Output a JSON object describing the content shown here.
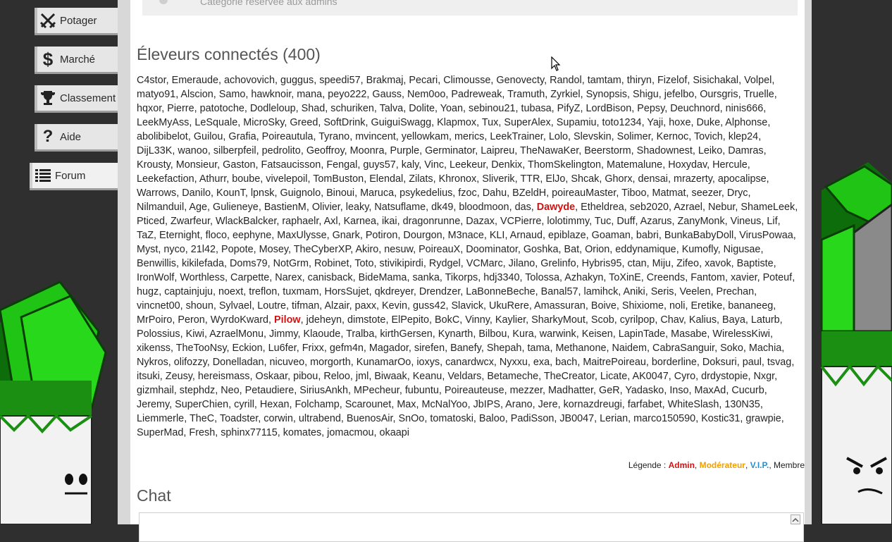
{
  "nav": [
    {
      "label": "Potager",
      "icon": "swords-icon"
    },
    {
      "label": "Marché",
      "icon": "dollar-icon"
    },
    {
      "label": "Classement",
      "icon": "trophy-icon"
    },
    {
      "label": "Aide",
      "icon": "question-icon"
    },
    {
      "label": "Forum",
      "icon": "list-icon"
    }
  ],
  "category_note": "Catégorie réservée aux admins",
  "online_title": "Éleveurs connectés (400)",
  "users": [
    "C4stor",
    "Emeraude",
    "achovovich",
    "guggus",
    "speedi57",
    "Brakmaj",
    "Pecari",
    "Climousse",
    "Genovecty",
    "Randol",
    "tamtam",
    "thiryn",
    "Fizelof",
    "Sisichakal",
    "Volpel",
    "matyo91",
    "Alscion",
    "Samo",
    "hawknoir",
    "mana",
    "peyo222",
    "Gauss",
    "Nem0oo",
    "Padreweak",
    "Tramuth",
    "Zyrkiel",
    "Synopsis",
    "Shigu",
    "jefelbo",
    "Oursgris",
    "Truelle",
    "hqxor",
    "Pierre",
    "patotoche",
    "Dodleloup",
    "Shad",
    "schuriken",
    "Talva",
    "Dolite",
    "Yoan",
    "sebinou21",
    "tubasa",
    "PifyZ",
    "LordBison",
    "Pepsy",
    "Deuchnord",
    "ninis666",
    "LeekMyAss",
    "LeSquale",
    "MicroSky",
    "Greed",
    "SoftDrink",
    "GuiguiSwagg",
    "Klapmox",
    "Tux",
    "SuperAlex",
    "Supamiu",
    "toto1234",
    "Yaji",
    "hoxe",
    "Duke",
    "Alphonse",
    "abolibibelot",
    "Guilou",
    "Grafia",
    "Poireautula",
    "Tyrano",
    "mvincent",
    "yellowkam",
    "merics",
    "LeekTrainer",
    "Lolo",
    "Slevskin",
    "Solimer",
    "Kernoc",
    "Tovich",
    "klep24",
    "DijL33K",
    "wanoo",
    "silberpfeil",
    "pedrolito",
    "Geoffroy",
    "Moonra",
    "Purple",
    "Germinator",
    "Laipreu",
    "TheNawaKer",
    "Beerstorm",
    "Shadownest",
    "Leiko",
    "Damras",
    "Krousty",
    "Monsieur",
    "Gaston",
    "Fatsaucisson",
    "Fengal",
    "guys57",
    "kaly",
    "Vinc",
    "Leekeur",
    "Denkix",
    "ThomSkelington",
    "Matemalune",
    "Hoxydav",
    "Hercule",
    "Leekefaction",
    "Athurr",
    "boube",
    "vivelepoil",
    "TomBuston",
    "Elendal",
    "Zilats",
    "Khronox",
    "Sliverik",
    "TTR",
    "ElJo",
    "Shcak",
    "Ghorx",
    "densai",
    "mrazerty",
    "apocalipse",
    "Warrows",
    "Danilo",
    "KounT",
    "lpnsk",
    "Guignolo",
    "Binoui",
    "Maruca",
    "psykedelius",
    "fzoc",
    "Dahu",
    "BZeldH",
    "poireauMaster",
    "Tiboo",
    "Matmat",
    "seezer",
    "Dryc",
    "Nilmanduil",
    "Age",
    "Gulieneye",
    "BastienM",
    "Olivier",
    "leaky",
    "Natsuflame",
    "dk49",
    "bloodmoon",
    "das",
    "Dawyde",
    "Etheldrea",
    "seb2020",
    "Azrael",
    "Nebur",
    "ShameLeek",
    "Pticed",
    "Zwarfeur",
    "WlackBalcker",
    "raphaelr",
    "Axl",
    "Karnea",
    "ikai",
    "dragonrunne",
    "Dazax",
    "VCPierre",
    "lolotimmy",
    "Tuc",
    "Duff",
    "Azarus",
    "ZanyMonk",
    "Vineus",
    "Lif",
    "TaZ",
    "Eternight",
    "floco",
    "eephyne",
    "MaxUlysse",
    "Gnark",
    "Potiron",
    "Dourgon",
    "M3nace",
    "KLI",
    "Arnaud",
    "epiblaze",
    "Goaman",
    "babri",
    "BunkaBabyDoll",
    "VirusPowaa",
    "Myst",
    "nyco",
    "21l42",
    "Popote",
    "Mosey",
    "TheCyberXP",
    "Akiro",
    "nesuw",
    "PoireauX",
    "Doominator",
    "Goshka",
    "Bat",
    "Orion",
    "eddynamique",
    "Kumofly",
    "Nigusae",
    "Benwillis",
    "kikilefada",
    "Doms79",
    "NotGrm",
    "Robinet",
    "Toto",
    "stivikipirdi",
    "Rydgel",
    "VCMarc",
    "Jilano",
    "Grelinfo",
    "Hybris95",
    "ctan",
    "Miju",
    "Zifeo",
    "xavok",
    "Baptiste",
    "IronWolf",
    "Worthless",
    "Carpette",
    "Narex",
    "canisback",
    "BideMama",
    "sanka",
    "Tikorps",
    "hdj3340",
    "Tolossa",
    "Azhakyn",
    "ToXinE",
    "Creends",
    "Fantom",
    "xavier",
    "Poteuf",
    "hugz",
    "captainjuju",
    "noext",
    "treflon",
    "tuxmam",
    "HorsSujet",
    "qkdreyer",
    "Drendzer",
    "LaBonneBeche",
    "Banal57",
    "lamihck",
    "Aniki",
    "Seris",
    "Veelen",
    "Prechan",
    "vincnet00",
    "shoun",
    "Sylvael",
    "Loutre",
    "tifman",
    "Alzair",
    "paxx",
    "Kevin",
    "guss42",
    "Slavick",
    "UkuRere",
    "Amassuran",
    "Boive",
    "Shixiome",
    "noli",
    "Eretike",
    "bananeeg",
    "MrPoiro",
    "Peron",
    "WyrdoKward",
    "Pilow",
    "jdeheyn",
    "dimstote",
    "ElPepito",
    "BokC",
    "Vinny",
    "Kaylier",
    "SharkyMout",
    "Scob",
    "cyrilpop",
    "Chav",
    "Kalius",
    "Baya",
    "Laturb",
    "Polossius",
    "Kiwi",
    "AzraelMonu",
    "Jimmy",
    "Klaoude",
    "Tralba",
    "kirthGersen",
    "Kynarth",
    "Bilbou",
    "Kura",
    "warwink",
    "Keisen",
    "LapinTade",
    "Masabe",
    "WirelessKiwi",
    "xikenss",
    "TheTooNsy",
    "Eckion",
    "Lu6fer",
    "Frixx",
    "gefm4n",
    "Magador",
    "sirefen",
    "Banefy",
    "Shepah",
    "tama",
    "Methanone",
    "Naidem",
    "CabraSanguir",
    "Soko",
    "Machia",
    "Nykros",
    "olifozzy",
    "Donelladan",
    "nicuveo",
    "morgorth",
    "KunamarOo",
    "ioxys",
    "canardwcx",
    "Nyxxu",
    "exa",
    "bach",
    "MaitrePoireau",
    "borderline",
    "Doksuri",
    "paul",
    "tsvag",
    "itsuki",
    "Zeusy",
    "hereismass",
    "Oskaar",
    "pibou",
    "Reloo",
    "jml",
    "Biwaak",
    "Keanu",
    "Veldars",
    "Betameche",
    "TheCreator",
    "Licate",
    "AK0047",
    "Cyro",
    "drdystopie",
    "Nxgr",
    "gizmhail",
    "stephdz",
    "Neo",
    "Petaudiere",
    "SiriusAnkh",
    "MPecheur",
    "fubuntu",
    "Poireauteuse",
    "mezzer",
    "Madhatter",
    "GeR",
    "Yadasko",
    "Inso",
    "MaxAd",
    "Cucurb",
    "Jeremy",
    "SuperChien",
    "cyrill",
    "Hexan",
    "Folchamp",
    "Scarounet",
    "Max",
    "McNalYoo",
    "JbIPS",
    "Arano",
    "Jere",
    "kornazdreugi",
    "farfabet",
    "WhiteSlash",
    "130N35",
    "Liemmerle",
    "TheC",
    "Toadster",
    "corwin",
    "ultrabend",
    "BuenosAir",
    "SnOo",
    "tomatoski",
    "Baloo",
    "PadiSson",
    "JB0047",
    "Lerian",
    "marco150590",
    "Kostic31",
    "grawpie",
    "SuperMad",
    "Fresh",
    "sphinx77115",
    "komates",
    "jomacmou",
    "okaapi"
  ],
  "admins": [
    "Dawyde",
    "Pilow"
  ],
  "legend": {
    "prefix": "Légende : ",
    "admin": "Admin",
    "moderator": "Modérateur",
    "vip": "V.I.P.",
    "member": "Membre",
    "sep": ", "
  },
  "chat_title": "Chat",
  "colors": {
    "admin": "#d01414",
    "moderator": "#f0a000",
    "vip": "#2a8fd0",
    "leek_green": "#1fc414"
  }
}
